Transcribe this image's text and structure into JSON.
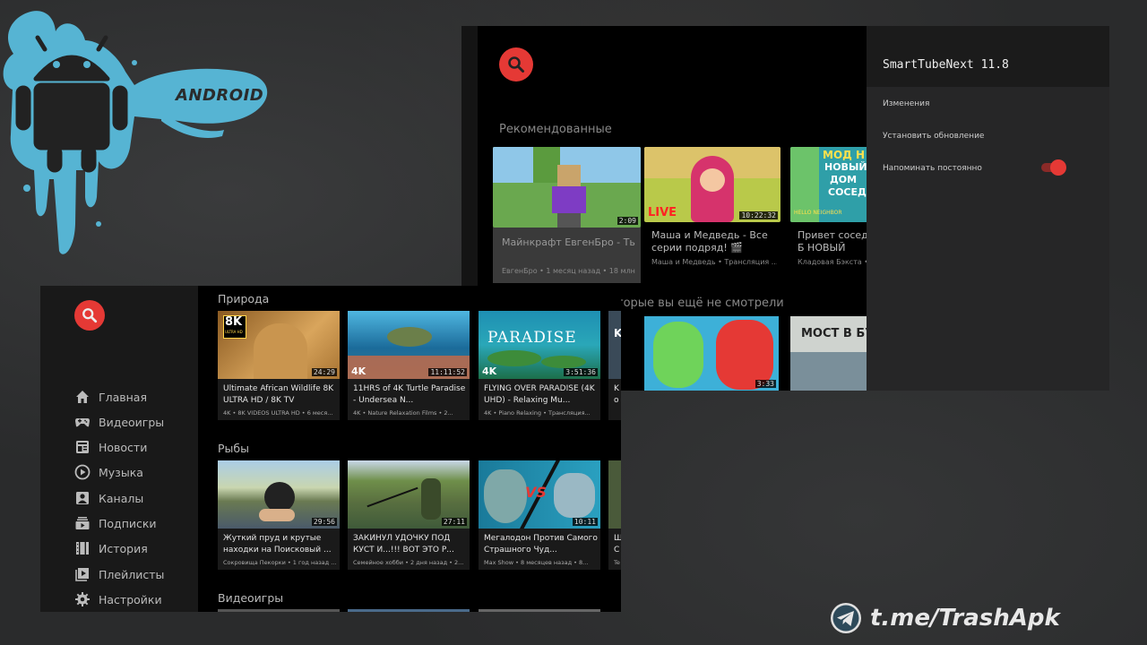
{
  "branding": {
    "android_wordmark": "ANDROID"
  },
  "back_window": {
    "row_recommended": "Рекомендованные",
    "row_unseen": "торые вы ещё не смотрели",
    "cards": [
      {
        "title": "Майнкрафт ЕвгенБро - Ть",
        "meta": "ЕвгенБро • 1 месяц назад • 18 млн",
        "duration": "2:09"
      },
      {
        "title": "Маша и Медведь - Все серии подряд! 🎬",
        "meta": "Маша и Медведь • Трансляция ...",
        "duration": "10:22:32",
        "badge": "LIVE"
      },
      {
        "title": "Привет сосед Б НОВЫЙ ДОМ СОС",
        "meta": "Кладовая Бэкста • ",
        "thumb_text": [
          "МОД Н",
          "НОВЫЙ",
          "ДОМ",
          "СОСЕД"
        ],
        "thumb_small": "HELLO NEIGHBOR"
      }
    ],
    "unseen_cards": [
      {
        "duration": "3:33"
      },
      {
        "thumb_text": "МОСТ В БУ"
      }
    ]
  },
  "settings": {
    "title": "SmartTubeNext 11.8",
    "items": [
      "Изменения",
      "Установить обновление",
      "Напоминать постоянно"
    ],
    "remind_always_enabled": true,
    "accent": "#e53935"
  },
  "front_window": {
    "nav": [
      {
        "label": "Главная",
        "icon": "home-icon"
      },
      {
        "label": "Видеоигры",
        "icon": "gamepad-icon"
      },
      {
        "label": "Новости",
        "icon": "news-icon"
      },
      {
        "label": "Музыка",
        "icon": "music-icon"
      },
      {
        "label": "Каналы",
        "icon": "channels-icon"
      },
      {
        "label": "Подписки",
        "icon": "subscriptions-icon"
      },
      {
        "label": "История",
        "icon": "history-icon"
      },
      {
        "label": "Плейлисты",
        "icon": "playlists-icon"
      },
      {
        "label": "Настройки",
        "icon": "settings-icon"
      }
    ],
    "sections": [
      {
        "title": "Природа",
        "cards": [
          {
            "title": "Ultimate African Wildlife 8K ULTRA HD / 8K TV",
            "meta": "4K • 8K VIDEOS ULTRA HD • 6 меся...",
            "duration": "24:29",
            "badge": "8K",
            "badge_sub": "ULTRA HD"
          },
          {
            "title": "11HRS of 4K Turtle Paradise - Undersea N...",
            "meta": "4K • Nature Relaxation Films • 2...",
            "duration": "11:11:52",
            "badge": "4K"
          },
          {
            "title": "FLYING OVER PARADISE (4K UHD) - Relaxing Mu...",
            "meta": "4K • Piano Relaxing • Трансляция...",
            "duration": "3:51:36",
            "badge": "4K",
            "thumb_text": "PARADISE"
          },
          {
            "title": "K o",
            "meta": "",
            "thumb_text": "K"
          }
        ]
      },
      {
        "title": "Рыбы",
        "cards": [
          {
            "title": "Жуткий пруд и крутые находки на Поисковый ...",
            "meta": "Сокровища Пекорки • 1 год назад ...",
            "duration": "29:56"
          },
          {
            "title": "ЗАКИНУЛ УДОЧКУ ПОД КУСТ И...!!! ВОТ ЭТО Р...",
            "meta": "Семейное хобби • 2 дня назад • 2...",
            "duration": "27:11"
          },
          {
            "title": "Мегалодон Против Самого Страшного Чуд...",
            "meta": "Max Show • 8 месяцев назад • 8...",
            "duration": "10:11",
            "thumb_text": "VS"
          },
          {
            "title": "Ш С",
            "meta": "Te"
          }
        ]
      },
      {
        "title": "Видеоигры"
      }
    ]
  },
  "watermark": "t.me/TrashApk"
}
